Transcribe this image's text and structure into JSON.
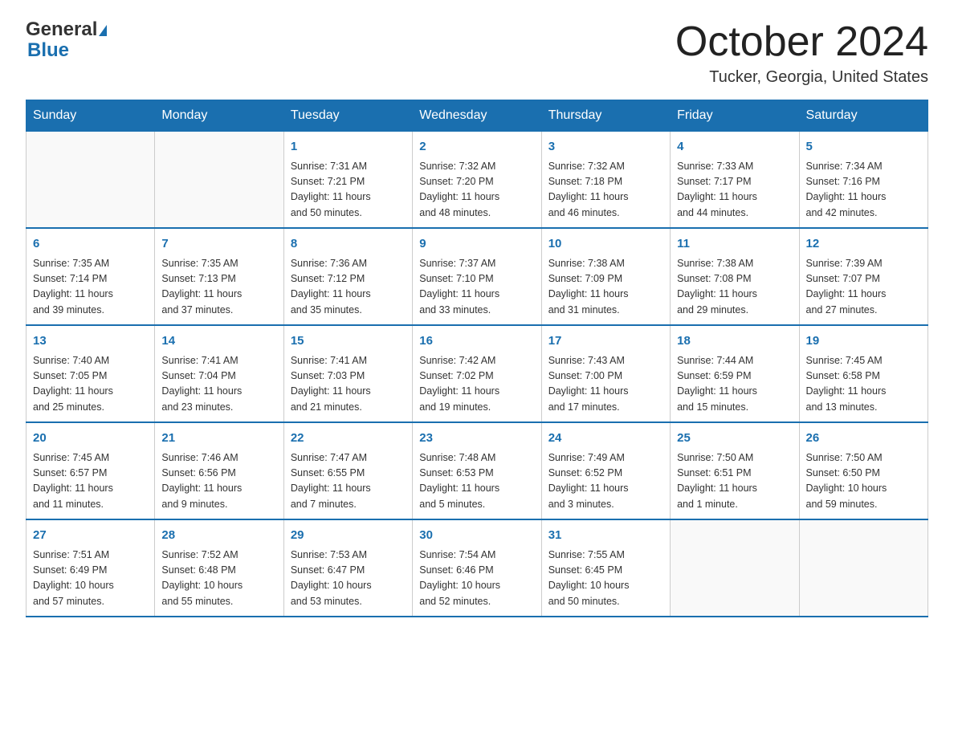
{
  "header": {
    "logo_general": "General",
    "logo_triangle_unicode": "▲",
    "logo_blue": "Blue",
    "month_title": "October 2024",
    "location": "Tucker, Georgia, United States"
  },
  "weekdays": [
    "Sunday",
    "Monday",
    "Tuesday",
    "Wednesday",
    "Thursday",
    "Friday",
    "Saturday"
  ],
  "weeks": [
    [
      {
        "day": "",
        "info": ""
      },
      {
        "day": "",
        "info": ""
      },
      {
        "day": "1",
        "info": "Sunrise: 7:31 AM\nSunset: 7:21 PM\nDaylight: 11 hours\nand 50 minutes."
      },
      {
        "day": "2",
        "info": "Sunrise: 7:32 AM\nSunset: 7:20 PM\nDaylight: 11 hours\nand 48 minutes."
      },
      {
        "day": "3",
        "info": "Sunrise: 7:32 AM\nSunset: 7:18 PM\nDaylight: 11 hours\nand 46 minutes."
      },
      {
        "day": "4",
        "info": "Sunrise: 7:33 AM\nSunset: 7:17 PM\nDaylight: 11 hours\nand 44 minutes."
      },
      {
        "day": "5",
        "info": "Sunrise: 7:34 AM\nSunset: 7:16 PM\nDaylight: 11 hours\nand 42 minutes."
      }
    ],
    [
      {
        "day": "6",
        "info": "Sunrise: 7:35 AM\nSunset: 7:14 PM\nDaylight: 11 hours\nand 39 minutes."
      },
      {
        "day": "7",
        "info": "Sunrise: 7:35 AM\nSunset: 7:13 PM\nDaylight: 11 hours\nand 37 minutes."
      },
      {
        "day": "8",
        "info": "Sunrise: 7:36 AM\nSunset: 7:12 PM\nDaylight: 11 hours\nand 35 minutes."
      },
      {
        "day": "9",
        "info": "Sunrise: 7:37 AM\nSunset: 7:10 PM\nDaylight: 11 hours\nand 33 minutes."
      },
      {
        "day": "10",
        "info": "Sunrise: 7:38 AM\nSunset: 7:09 PM\nDaylight: 11 hours\nand 31 minutes."
      },
      {
        "day": "11",
        "info": "Sunrise: 7:38 AM\nSunset: 7:08 PM\nDaylight: 11 hours\nand 29 minutes."
      },
      {
        "day": "12",
        "info": "Sunrise: 7:39 AM\nSunset: 7:07 PM\nDaylight: 11 hours\nand 27 minutes."
      }
    ],
    [
      {
        "day": "13",
        "info": "Sunrise: 7:40 AM\nSunset: 7:05 PM\nDaylight: 11 hours\nand 25 minutes."
      },
      {
        "day": "14",
        "info": "Sunrise: 7:41 AM\nSunset: 7:04 PM\nDaylight: 11 hours\nand 23 minutes."
      },
      {
        "day": "15",
        "info": "Sunrise: 7:41 AM\nSunset: 7:03 PM\nDaylight: 11 hours\nand 21 minutes."
      },
      {
        "day": "16",
        "info": "Sunrise: 7:42 AM\nSunset: 7:02 PM\nDaylight: 11 hours\nand 19 minutes."
      },
      {
        "day": "17",
        "info": "Sunrise: 7:43 AM\nSunset: 7:00 PM\nDaylight: 11 hours\nand 17 minutes."
      },
      {
        "day": "18",
        "info": "Sunrise: 7:44 AM\nSunset: 6:59 PM\nDaylight: 11 hours\nand 15 minutes."
      },
      {
        "day": "19",
        "info": "Sunrise: 7:45 AM\nSunset: 6:58 PM\nDaylight: 11 hours\nand 13 minutes."
      }
    ],
    [
      {
        "day": "20",
        "info": "Sunrise: 7:45 AM\nSunset: 6:57 PM\nDaylight: 11 hours\nand 11 minutes."
      },
      {
        "day": "21",
        "info": "Sunrise: 7:46 AM\nSunset: 6:56 PM\nDaylight: 11 hours\nand 9 minutes."
      },
      {
        "day": "22",
        "info": "Sunrise: 7:47 AM\nSunset: 6:55 PM\nDaylight: 11 hours\nand 7 minutes."
      },
      {
        "day": "23",
        "info": "Sunrise: 7:48 AM\nSunset: 6:53 PM\nDaylight: 11 hours\nand 5 minutes."
      },
      {
        "day": "24",
        "info": "Sunrise: 7:49 AM\nSunset: 6:52 PM\nDaylight: 11 hours\nand 3 minutes."
      },
      {
        "day": "25",
        "info": "Sunrise: 7:50 AM\nSunset: 6:51 PM\nDaylight: 11 hours\nand 1 minute."
      },
      {
        "day": "26",
        "info": "Sunrise: 7:50 AM\nSunset: 6:50 PM\nDaylight: 10 hours\nand 59 minutes."
      }
    ],
    [
      {
        "day": "27",
        "info": "Sunrise: 7:51 AM\nSunset: 6:49 PM\nDaylight: 10 hours\nand 57 minutes."
      },
      {
        "day": "28",
        "info": "Sunrise: 7:52 AM\nSunset: 6:48 PM\nDaylight: 10 hours\nand 55 minutes."
      },
      {
        "day": "29",
        "info": "Sunrise: 7:53 AM\nSunset: 6:47 PM\nDaylight: 10 hours\nand 53 minutes."
      },
      {
        "day": "30",
        "info": "Sunrise: 7:54 AM\nSunset: 6:46 PM\nDaylight: 10 hours\nand 52 minutes."
      },
      {
        "day": "31",
        "info": "Sunrise: 7:55 AM\nSunset: 6:45 PM\nDaylight: 10 hours\nand 50 minutes."
      },
      {
        "day": "",
        "info": ""
      },
      {
        "day": "",
        "info": ""
      }
    ]
  ]
}
